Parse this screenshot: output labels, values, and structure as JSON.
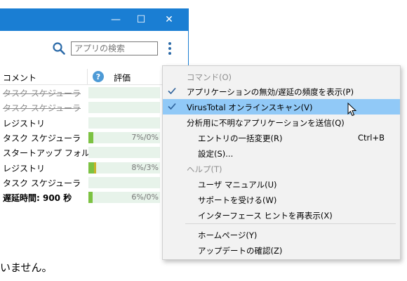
{
  "window": {
    "minimize_glyph": "—",
    "maximize_glyph": "☐",
    "close_glyph": "✕"
  },
  "search": {
    "placeholder": "アプリの検索",
    "icon": "search-icon"
  },
  "table": {
    "columns": {
      "comment": "コメント",
      "rating": "評価",
      "help_glyph": "?"
    },
    "rows": [
      {
        "comment": "タスク スケジューラ",
        "style": "strike",
        "fill1": 0,
        "fill2": 0,
        "pct": ""
      },
      {
        "comment": "タスク スケジューラ",
        "style": "strike",
        "fill1": 0,
        "fill2": 0,
        "pct": ""
      },
      {
        "comment": "レジストリ",
        "style": "normal",
        "fill1": 0,
        "fill2": 0,
        "pct": ""
      },
      {
        "comment": "タスク スケジューラ",
        "style": "normal",
        "fill1": 0.07,
        "fill2": 0,
        "pct": "7%/0%"
      },
      {
        "comment": "スタートアップ フォルダ",
        "style": "normal",
        "fill1": 0,
        "fill2": 0,
        "pct": ""
      },
      {
        "comment": "レジストリ",
        "style": "normal",
        "fill1": 0.08,
        "fill2": 0.03,
        "pct": "8%/3%"
      },
      {
        "comment": "タスク スケジューラ",
        "style": "normal",
        "fill1": 0,
        "fill2": 0,
        "pct": ""
      },
      {
        "comment": "遅延時間: 900 秒",
        "style": "bold",
        "fill1": 0.06,
        "fill2": 0,
        "pct": "6%/0%"
      }
    ]
  },
  "body_text": "いません。",
  "menu": {
    "items": [
      {
        "type": "header",
        "label": "コマンド(O)"
      },
      {
        "type": "item",
        "label": "アプリケーションの無効/遅延の頻度を表示(P)",
        "checked": true,
        "highlighted": false,
        "shortcut": ""
      },
      {
        "type": "item",
        "label": "VirusTotal オンラインスキャン(V)",
        "checked": true,
        "highlighted": true,
        "shortcut": ""
      },
      {
        "type": "item",
        "label": "分析用に不明なアプリケーションを送信(Q)",
        "checked": false,
        "highlighted": false,
        "shortcut": ""
      },
      {
        "type": "sub",
        "label": "エントリの一括変更(R)",
        "shortcut": "Ctrl+B"
      },
      {
        "type": "sub",
        "label": "設定(S)..."
      },
      {
        "type": "header",
        "label": "ヘルプ(T)"
      },
      {
        "type": "sub",
        "label": "ユーザ マニュアル(U)"
      },
      {
        "type": "sub",
        "label": "サポートを受ける(W)"
      },
      {
        "type": "sub",
        "label": "インターフェース ヒントを再表示(X)"
      },
      {
        "type": "separator"
      },
      {
        "type": "sub",
        "label": "ホームページ(Y)"
      },
      {
        "type": "sub",
        "label": "アップデートの確認(Z)"
      }
    ]
  },
  "colors": {
    "titlebar": "#1a7ed3",
    "highlight": "#91c9f7",
    "bar_good": "#7cc242",
    "bar_warn": "#c9b32a",
    "bar_bg": "#e7f3ea"
  }
}
